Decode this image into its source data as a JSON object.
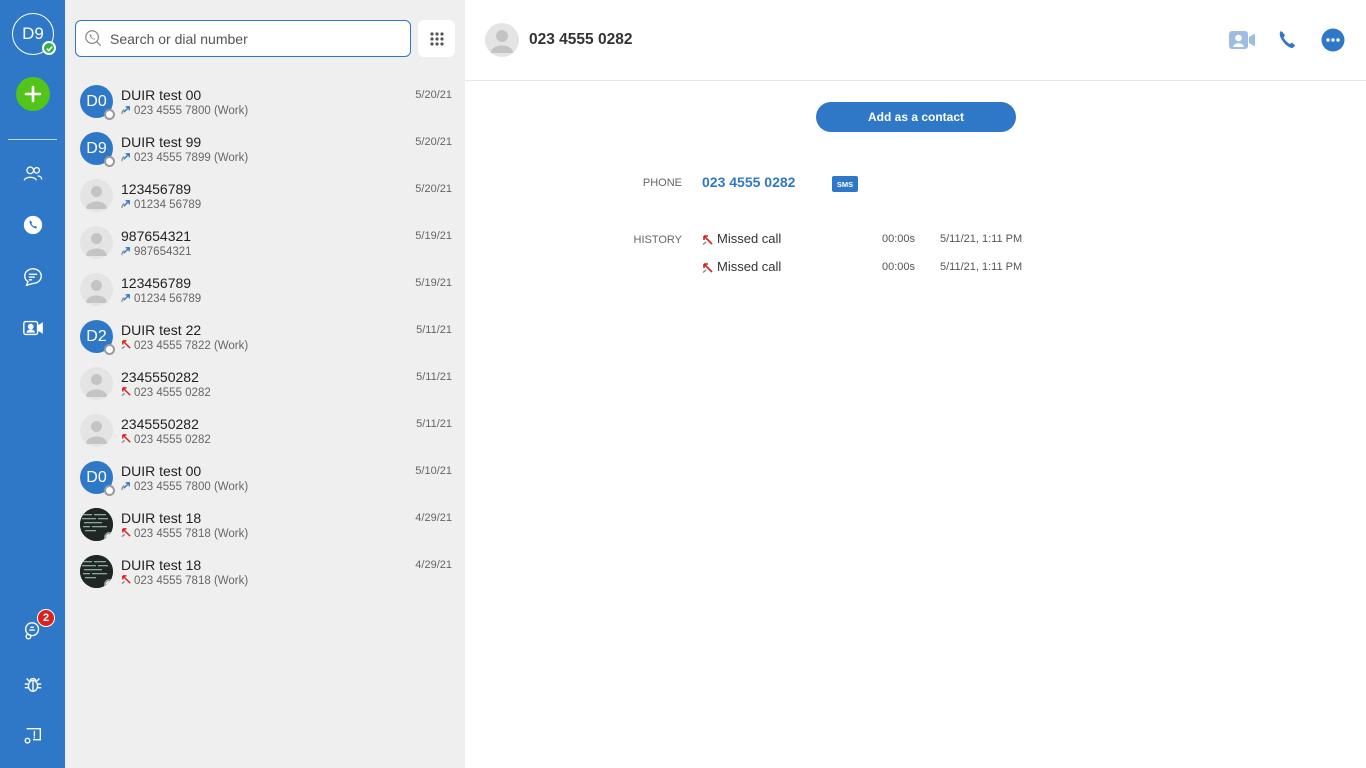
{
  "rail": {
    "avatar_initials": "D9",
    "voicemail_badge": "2"
  },
  "search": {
    "placeholder": "Search or dial number"
  },
  "conversations": [
    {
      "name": "DUIR test 00",
      "number": "023 4555 7800 (Work)",
      "date": "5/20/21",
      "avatar": "D0",
      "kind": "initials",
      "call": "outgoing"
    },
    {
      "name": "DUIR test 99",
      "number": "023 4555 7899 (Work)",
      "date": "5/20/21",
      "avatar": "D9",
      "kind": "initials",
      "call": "outgoing"
    },
    {
      "name": "123456789",
      "number": "01234 56789",
      "date": "5/20/21",
      "avatar": "",
      "kind": "anon",
      "call": "outgoing"
    },
    {
      "name": "987654321",
      "number": "987654321",
      "date": "5/19/21",
      "avatar": "",
      "kind": "anon",
      "call": "outgoing"
    },
    {
      "name": "123456789",
      "number": "01234 56789",
      "date": "5/19/21",
      "avatar": "",
      "kind": "anon",
      "call": "outgoing"
    },
    {
      "name": "DUIR test 22",
      "number": "023 4555 7822 (Work)",
      "date": "5/11/21",
      "avatar": "D2",
      "kind": "initials",
      "call": "missed"
    },
    {
      "name": "2345550282",
      "number": "023 4555 0282",
      "date": "5/11/21",
      "avatar": "",
      "kind": "anon",
      "call": "missed"
    },
    {
      "name": "2345550282",
      "number": "023 4555 0282",
      "date": "5/11/21",
      "avatar": "",
      "kind": "anon",
      "call": "missed"
    },
    {
      "name": "DUIR test 00",
      "number": "023 4555 7800 (Work)",
      "date": "5/10/21",
      "avatar": "D0",
      "kind": "initials",
      "call": "outgoing"
    },
    {
      "name": "DUIR test 18",
      "number": "023 4555 7818 (Work)",
      "date": "4/29/21",
      "avatar": "",
      "kind": "photo",
      "call": "missed"
    },
    {
      "name": "DUIR test 18",
      "number": "023 4555 7818 (Work)",
      "date": "4/29/21",
      "avatar": "",
      "kind": "photo",
      "call": "missed"
    }
  ],
  "detail": {
    "title": "023 4555 0282",
    "add_contact_label": "Add as a contact",
    "phone_label": "PHONE",
    "phone_value": "023 4555 0282",
    "sms_label": "SMS",
    "history_label": "HISTORY",
    "history": [
      {
        "type": "Missed call",
        "duration": "00:00s",
        "when": "5/11/21, 1:11 PM"
      },
      {
        "type": "Missed call",
        "duration": "00:00s",
        "when": "5/11/21, 1:11 PM"
      }
    ]
  },
  "colors": {
    "brand": "#2f78c7",
    "missed": "#d9221b",
    "add": "#52c41a"
  }
}
